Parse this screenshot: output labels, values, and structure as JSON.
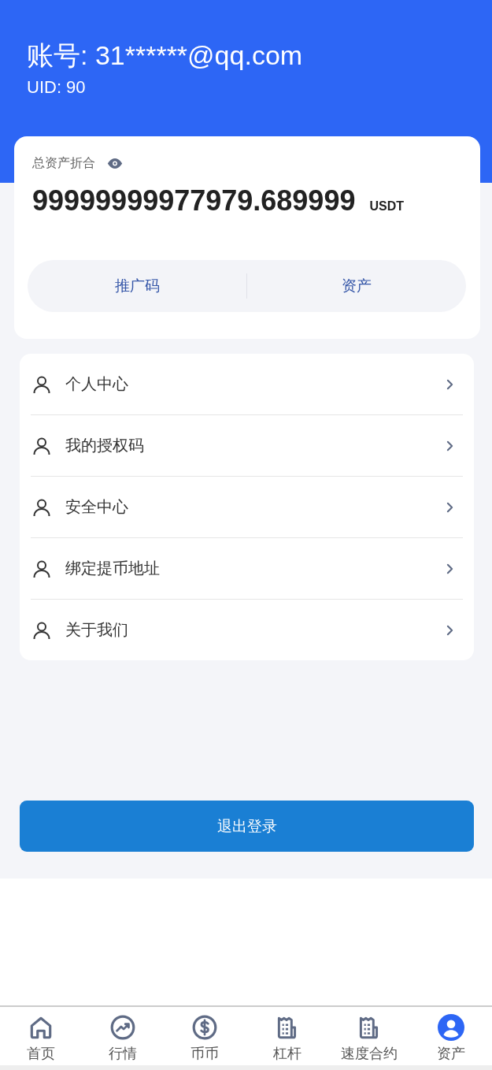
{
  "header": {
    "account": "账号: 31******@qq.com",
    "uid": "UID: 90"
  },
  "assets": {
    "label": "总资产折合",
    "amount": "99999999977979.689999",
    "unit": "USDT",
    "actions": [
      "推广码",
      "资产"
    ]
  },
  "menu": [
    {
      "label": "个人中心"
    },
    {
      "label": "我的授权码"
    },
    {
      "label": "安全中心"
    },
    {
      "label": "绑定提币地址"
    },
    {
      "label": "关于我们"
    }
  ],
  "logout": "退出登录",
  "tabbar": [
    {
      "label": "首页",
      "kind": "home",
      "selected": false
    },
    {
      "label": "行情",
      "kind": "trend",
      "selected": false
    },
    {
      "label": "币币",
      "kind": "coin",
      "selected": false
    },
    {
      "label": "杠杆",
      "kind": "receipt",
      "selected": false
    },
    {
      "label": "速度合约",
      "kind": "receipt",
      "selected": false
    },
    {
      "label": "资产",
      "kind": "user",
      "selected": true
    }
  ]
}
